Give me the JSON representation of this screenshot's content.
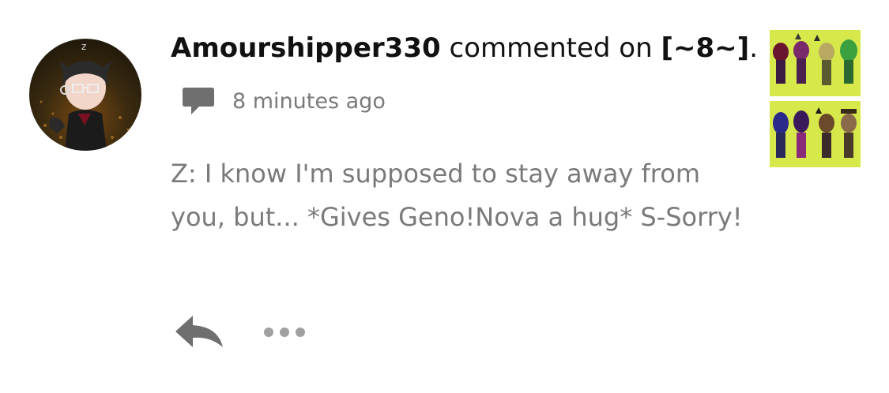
{
  "comment": {
    "username": "Amourshipper330",
    "action_text": " commented on ",
    "target_title": "[~8~]",
    "trailing_punct": ".",
    "timestamp": "8 minutes ago",
    "body": "Z: I know I'm supposed to stay away from you, but... *Gives Geno!Nova a hug* S-Sorry!"
  },
  "icons": {
    "comment": "comment-bubble-icon",
    "reply": "reply-arrow-icon",
    "more": "more-dots-icon"
  },
  "colors": {
    "username": "#111111",
    "muted_text": "#7a7a7a",
    "icon_gray": "#6f6f6f",
    "dots_gray": "#a0a0a0",
    "thumb_bg": "#d7e84a"
  }
}
